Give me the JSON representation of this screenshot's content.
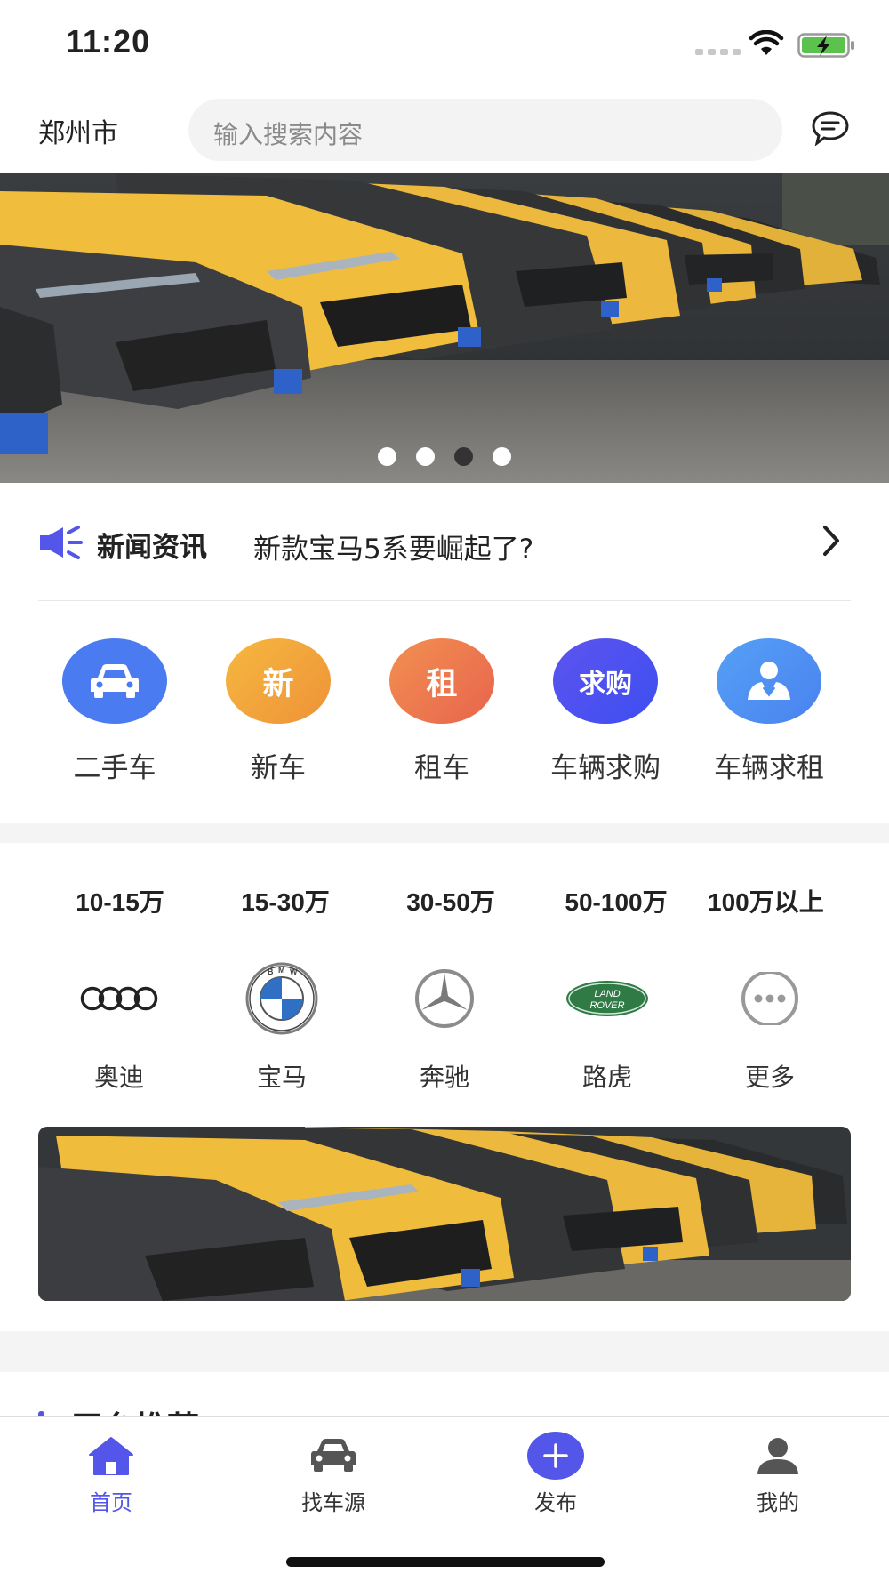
{
  "status_bar": {
    "time": "11:20"
  },
  "header": {
    "city": "郑州市",
    "search_placeholder": "输入搜索内容"
  },
  "banner": {
    "dots": 4,
    "active_dot_index": 2
  },
  "news": {
    "label": "新闻资讯",
    "headline": "新款宝马5系要崛起了?"
  },
  "categories": [
    {
      "label": "二手车",
      "icon": "car-icon",
      "color": "#4a7bf0"
    },
    {
      "label": "新车",
      "icon_text": "新",
      "color": "#f2a03c"
    },
    {
      "label": "租车",
      "icon_text": "租",
      "color": "#ee7a50"
    },
    {
      "label": "车辆求购",
      "icon_text": "求购",
      "color": "#4a4ef0"
    },
    {
      "label": "车辆求租",
      "icon": "user-icon",
      "color": "#4a8ff2"
    }
  ],
  "price_ranges": [
    "10-15万",
    "15-30万",
    "30-50万",
    "50-100万",
    "100万以上"
  ],
  "brands": [
    {
      "label": "奥迪",
      "logo": "audi-logo"
    },
    {
      "label": "宝马",
      "logo": "bmw-logo"
    },
    {
      "label": "奔驰",
      "logo": "mercedes-logo"
    },
    {
      "label": "路虎",
      "logo": "land-rover-logo",
      "logo_text_1": "LAND",
      "logo_text_2": "ROVER"
    },
    {
      "label": "更多",
      "logo": "more-icon"
    }
  ],
  "bmw_letters": {
    "b": "B",
    "m": "M",
    "w": "W"
  },
  "section": {
    "title": "平台推荐"
  },
  "tabbar": {
    "tabs": [
      {
        "label": "首页",
        "icon": "home-icon",
        "active": true
      },
      {
        "label": "找车源",
        "icon": "car-icon",
        "active": false
      },
      {
        "label": "发布",
        "icon": "plus-icon",
        "active": false
      },
      {
        "label": "我的",
        "icon": "user-icon",
        "active": false
      }
    ]
  },
  "colors": {
    "accent": "#5356e8",
    "search_bg": "#f3f3f3",
    "band": "#f4f4f4"
  }
}
